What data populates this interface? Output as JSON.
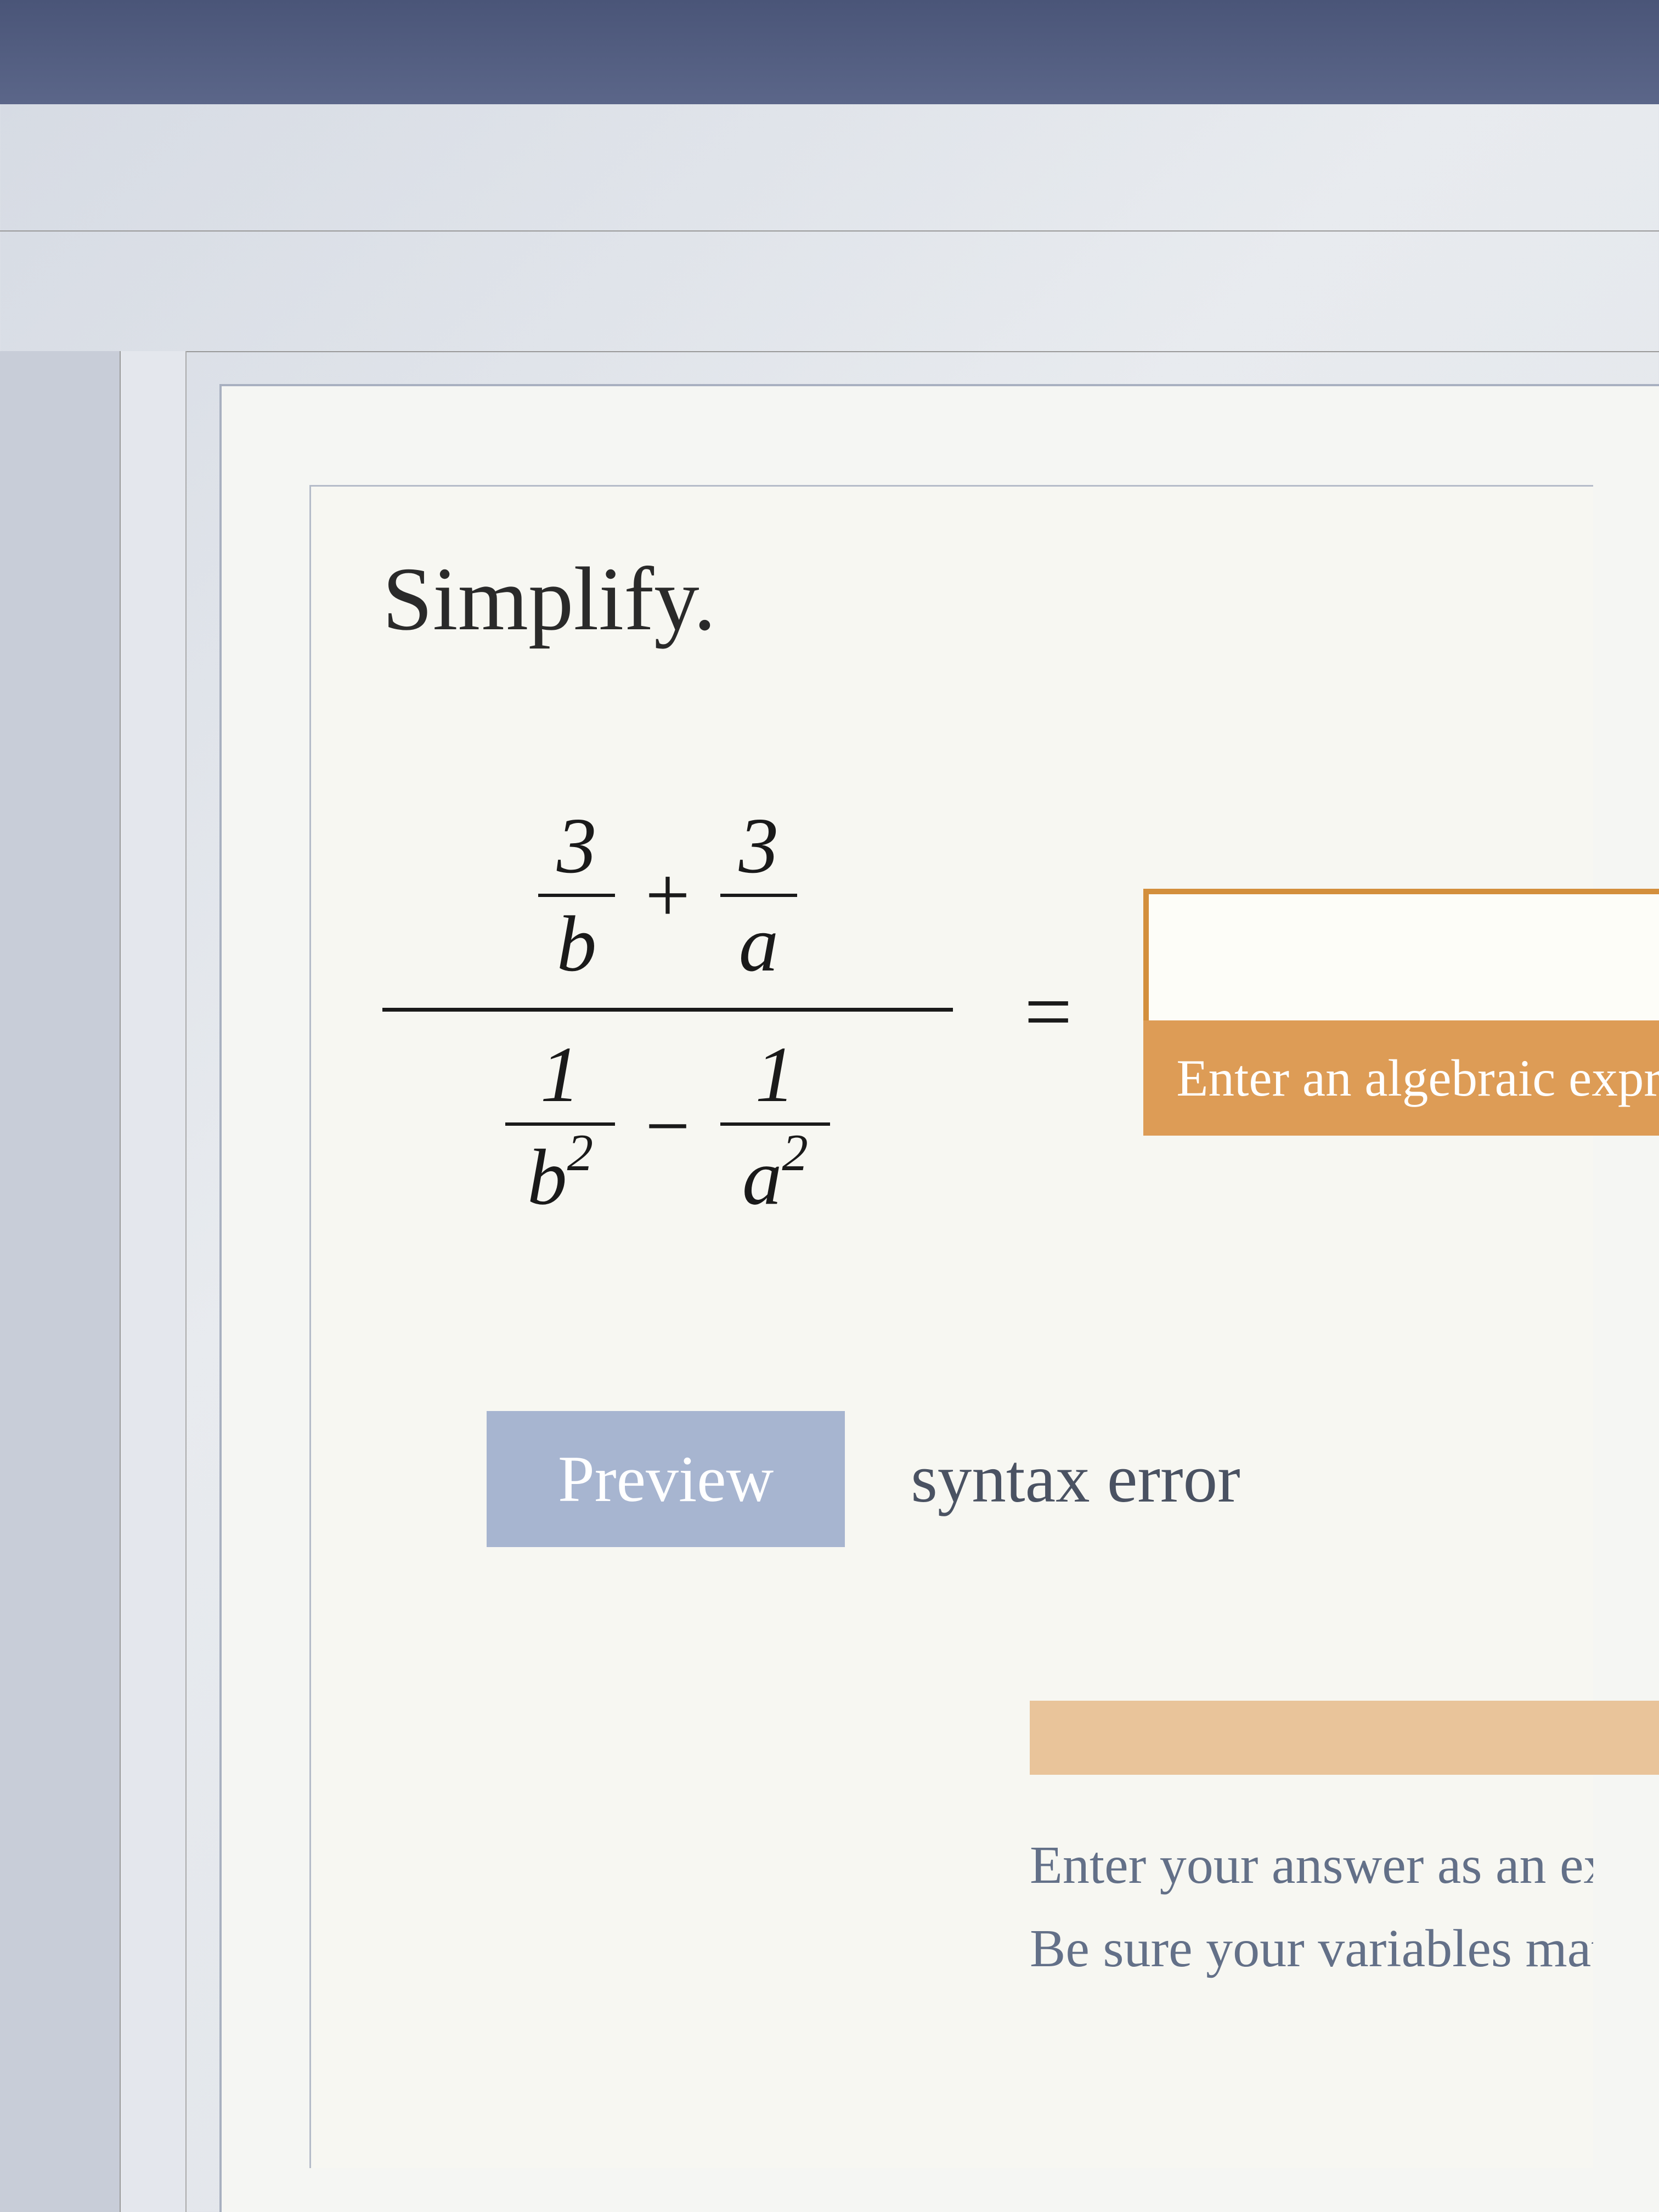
{
  "problem": {
    "title": "Simplify.",
    "numerator": {
      "frac1": {
        "num": "3",
        "den": "b"
      },
      "op": "+",
      "frac2": {
        "num": "3",
        "den": "a"
      }
    },
    "denominator": {
      "frac1": {
        "num": "1",
        "den_base": "b",
        "den_exp": "2"
      },
      "op": "−",
      "frac2": {
        "num": "1",
        "den_base": "a",
        "den_exp": "2"
      }
    },
    "equals": "="
  },
  "answer": {
    "value": "",
    "hint": "Enter an algebraic expre"
  },
  "preview": {
    "button": "Preview",
    "status": "syntax error"
  },
  "instructions": {
    "line1": "Enter your answer as an exp",
    "line2": "Be sure your variables matcl"
  }
}
